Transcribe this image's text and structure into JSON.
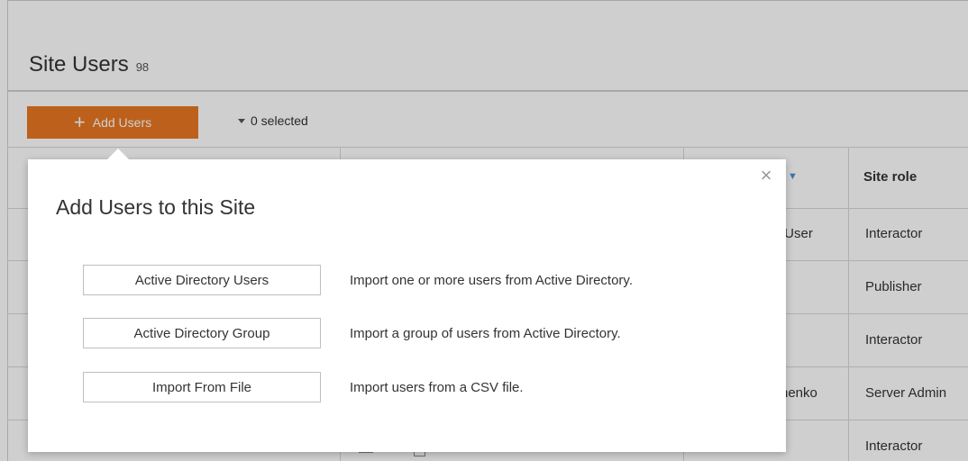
{
  "header": {
    "title": "Site Users",
    "count": "98"
  },
  "toolbar": {
    "add_users_label": "Add Users",
    "selected_label": "0 selected"
  },
  "table": {
    "columns": [
      "Site role"
    ],
    "rows": [
      {
        "name_fragment": "tUser",
        "site_role": "Interactor"
      },
      {
        "name_fragment": "",
        "site_role": "Publisher"
      },
      {
        "name_fragment": "",
        "site_role": "Interactor"
      },
      {
        "name_fragment": "nenko",
        "site_role": "Server Admin"
      },
      {
        "name_fragment": "",
        "site_role": "Interactor"
      }
    ]
  },
  "dialog": {
    "title": "Add Users to this Site",
    "options": [
      {
        "label": "Active Directory Users",
        "description": "Import one or more users from Active Directory."
      },
      {
        "label": "Active Directory Group",
        "description": "Import a group of users from Active Directory."
      },
      {
        "label": "Import From File",
        "description": "Import users from a CSV file."
      }
    ],
    "close_icon": "close-icon"
  },
  "colors": {
    "accent": "#e87722",
    "sort_arrow": "#4a8fd6"
  }
}
